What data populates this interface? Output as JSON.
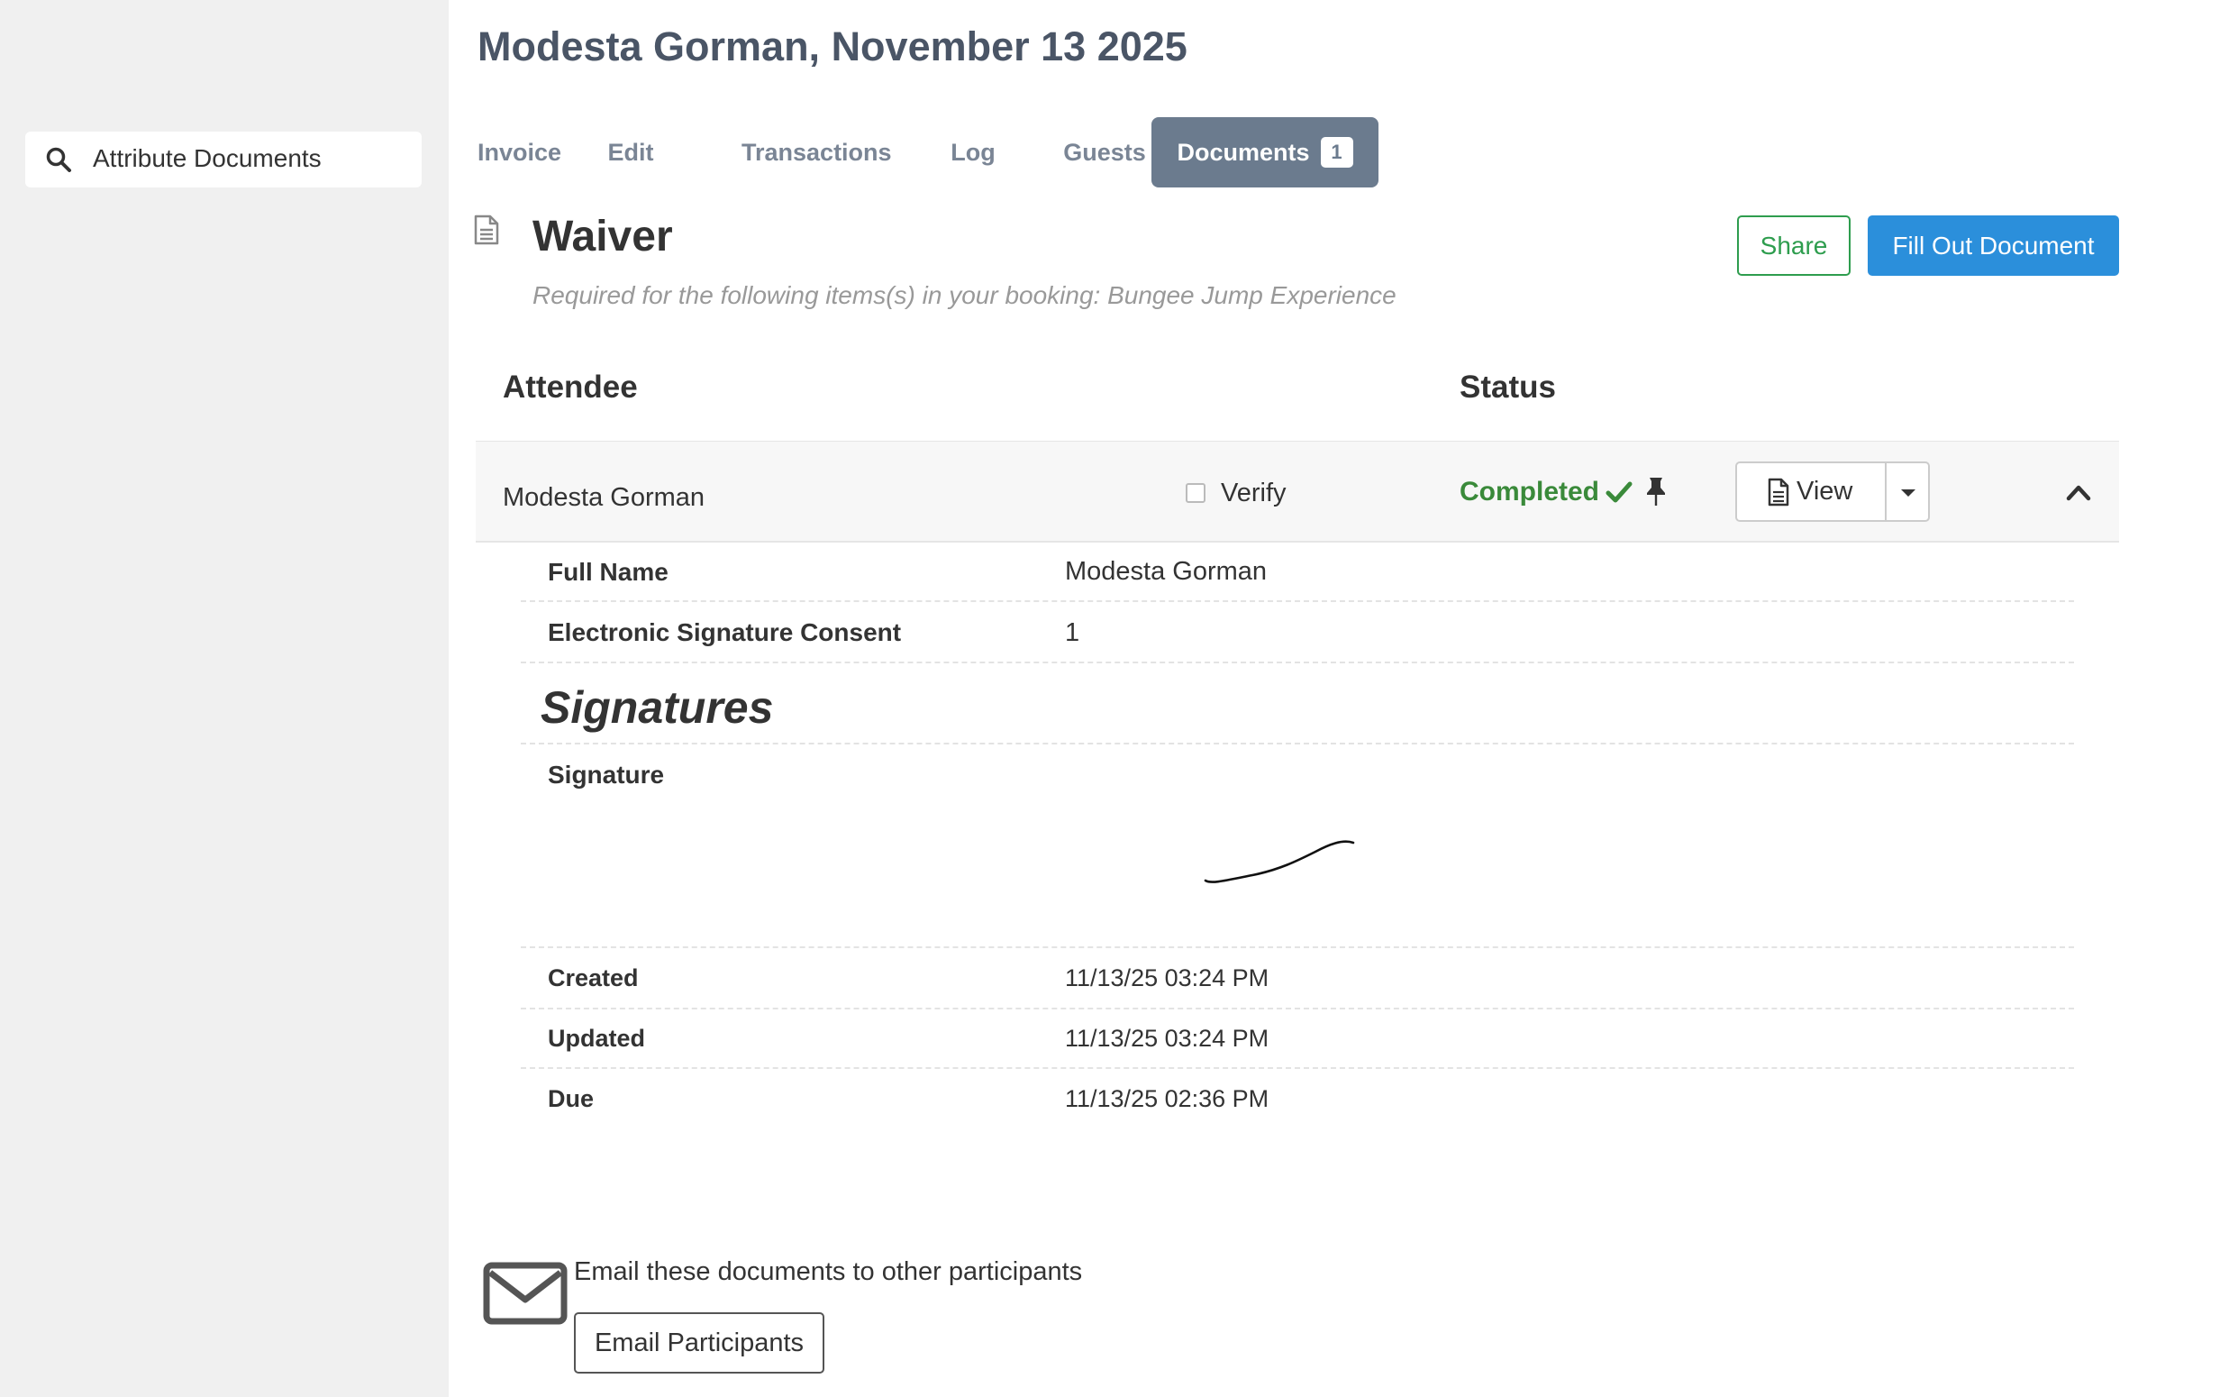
{
  "sidebar": {
    "search_icon": "search-icon",
    "search_label": "Attribute Documents"
  },
  "page_title": "Modesta Gorman, November 13 2025",
  "tabs": [
    {
      "label": "Invoice"
    },
    {
      "label": "Edit"
    },
    {
      "label": "Transactions"
    },
    {
      "label": "Log"
    },
    {
      "label": "Guests"
    },
    {
      "label": "Documents",
      "badge": "1",
      "active": true
    }
  ],
  "document": {
    "title": "Waiver",
    "subtitle": "Required for the following items(s) in your booking: Bungee Jump Experience",
    "share_label": "Share",
    "fill_label": "Fill Out Document"
  },
  "table": {
    "col_attendee": "Attendee",
    "col_status": "Status"
  },
  "attendee": {
    "name": "Modesta Gorman",
    "verify_label": "Verify",
    "verified": false,
    "status": "Completed",
    "view_label": "View"
  },
  "details": {
    "fields": [
      {
        "label": "Full Name",
        "value": "Modesta Gorman"
      },
      {
        "label": "Electronic Signature Consent",
        "value": "1"
      }
    ],
    "signatures_heading": "Signatures",
    "signature_label": "Signature",
    "meta": [
      {
        "label": "Created",
        "value": "11/13/25 03:24 PM"
      },
      {
        "label": "Updated",
        "value": "11/13/25 03:24 PM"
      },
      {
        "label": "Due",
        "value": "11/13/25 02:36 PM"
      }
    ]
  },
  "email": {
    "text": "Email these documents to other participants",
    "button_label": "Email Participants"
  },
  "colors": {
    "sidebar_bg": "#f0f0f0",
    "tab_active_bg": "#6b7b8e",
    "primary": "#2b8fdb",
    "success": "#2e9d4e",
    "status_completed": "#3a8a3a"
  }
}
